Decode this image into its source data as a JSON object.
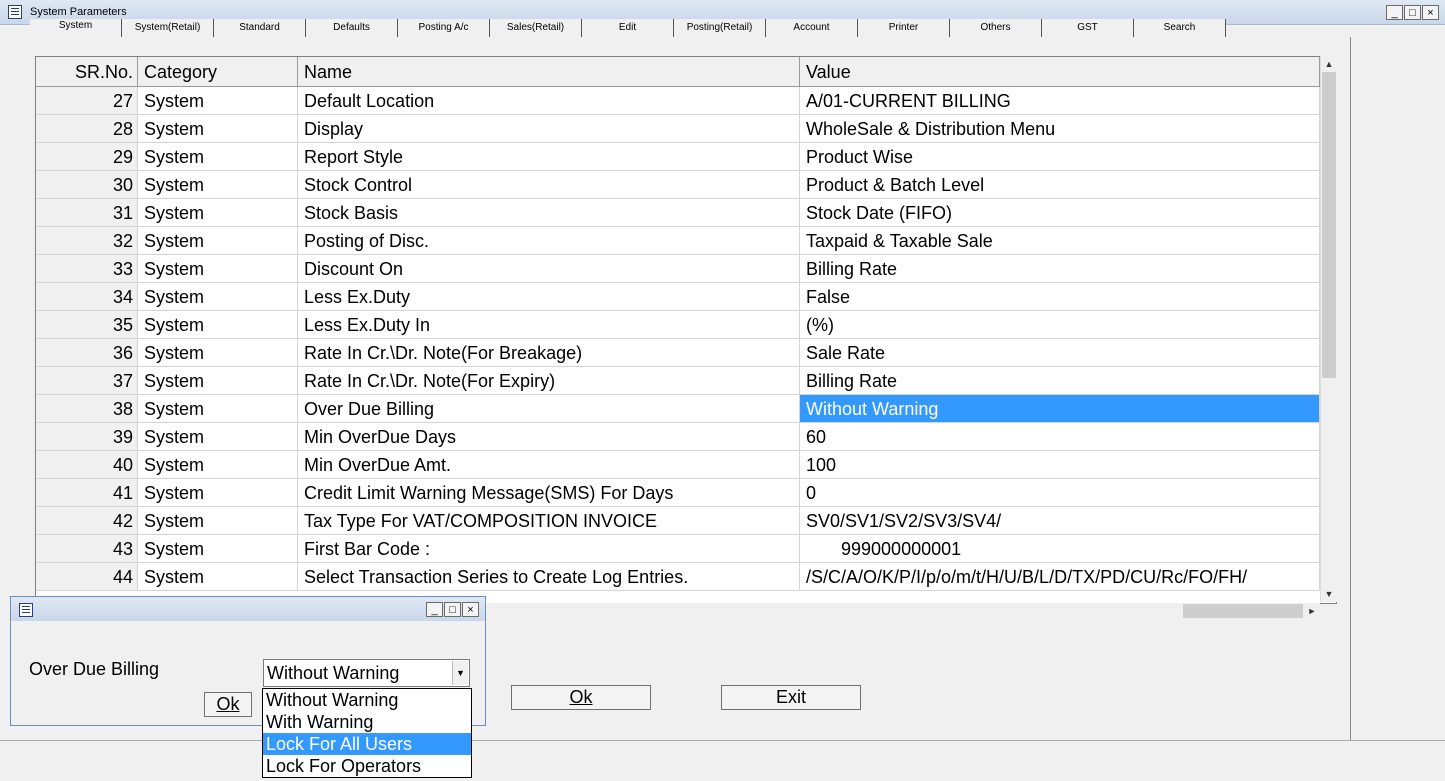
{
  "window": {
    "title": "System Parameters",
    "minimize": "_",
    "maximize": "□",
    "close": "×"
  },
  "tabs": [
    "System",
    "System(Retail)",
    "Standard",
    "Defaults",
    "Posting A/c",
    "Sales(Retail)",
    "Edit",
    "Posting(Retail)",
    "Account",
    "Printer",
    "Others",
    "GST",
    "Search"
  ],
  "grid": {
    "columns": [
      "SR.No.",
      "Category",
      "Name",
      "Value"
    ],
    "rows": [
      {
        "sr": "27",
        "category": "System",
        "name": "Default Location",
        "value": "A/01-CURRENT BILLING"
      },
      {
        "sr": "28",
        "category": "System",
        "name": "Display",
        "value": "WholeSale & Distribution Menu"
      },
      {
        "sr": "29",
        "category": "System",
        "name": "Report Style",
        "value": "Product Wise"
      },
      {
        "sr": "30",
        "category": "System",
        "name": "Stock Control",
        "value": "Product & Batch Level"
      },
      {
        "sr": "31",
        "category": "System",
        "name": "Stock Basis",
        "value": "Stock Date (FIFO)"
      },
      {
        "sr": "32",
        "category": "System",
        "name": "Posting of Disc.",
        "value": "Taxpaid & Taxable Sale"
      },
      {
        "sr": "33",
        "category": "System",
        "name": "Discount On",
        "value": "Billing Rate"
      },
      {
        "sr": "34",
        "category": "System",
        "name": "Less Ex.Duty",
        "value": "False"
      },
      {
        "sr": "35",
        "category": "System",
        "name": "Less Ex.Duty In",
        "value": "(%)"
      },
      {
        "sr": "36",
        "category": "System",
        "name": "Rate In Cr.\\Dr. Note(For Breakage)",
        "value": "Sale Rate"
      },
      {
        "sr": "37",
        "category": "System",
        "name": "Rate In Cr.\\Dr. Note(For Expiry)",
        "value": "Billing Rate"
      },
      {
        "sr": "38",
        "category": "System",
        "name": "Over Due Billing",
        "value": "Without Warning"
      },
      {
        "sr": "39",
        "category": "System",
        "name": "Min OverDue Days",
        "value": "60"
      },
      {
        "sr": "40",
        "category": "System",
        "name": "Min OverDue Amt.",
        "value": "100"
      },
      {
        "sr": "41",
        "category": "System",
        "name": "Credit Limit Warning Message(SMS) For Days",
        "value": "0"
      },
      {
        "sr": "42",
        "category": "System",
        "name": "Tax Type For VAT/COMPOSITION INVOICE",
        "value": "SV0/SV1/SV2/SV3/SV4/"
      },
      {
        "sr": "43",
        "category": "System",
        "name": "First Bar Code :",
        "value": "       999000000001"
      },
      {
        "sr": "44",
        "category": "System",
        "name": "Select Transaction Series to Create Log Entries.",
        "value": "/S/C/A/O/K/P/I/p/o/m/t/H/U/B/L/D/TX/PD/CU/Rc/FO/FH/"
      }
    ],
    "selected_row_index": 11
  },
  "buttons": {
    "ok": "Ok",
    "exit": "Exit"
  },
  "popup": {
    "label": "Over Due Billing",
    "combo_value": "Without Warning",
    "ok": "Ok",
    "options": [
      "Without Warning",
      "With Warning",
      "Lock For All Users",
      "Lock For Operators"
    ],
    "highlighted_option_index": 2
  },
  "colors": {
    "selection": "#3399ff"
  }
}
